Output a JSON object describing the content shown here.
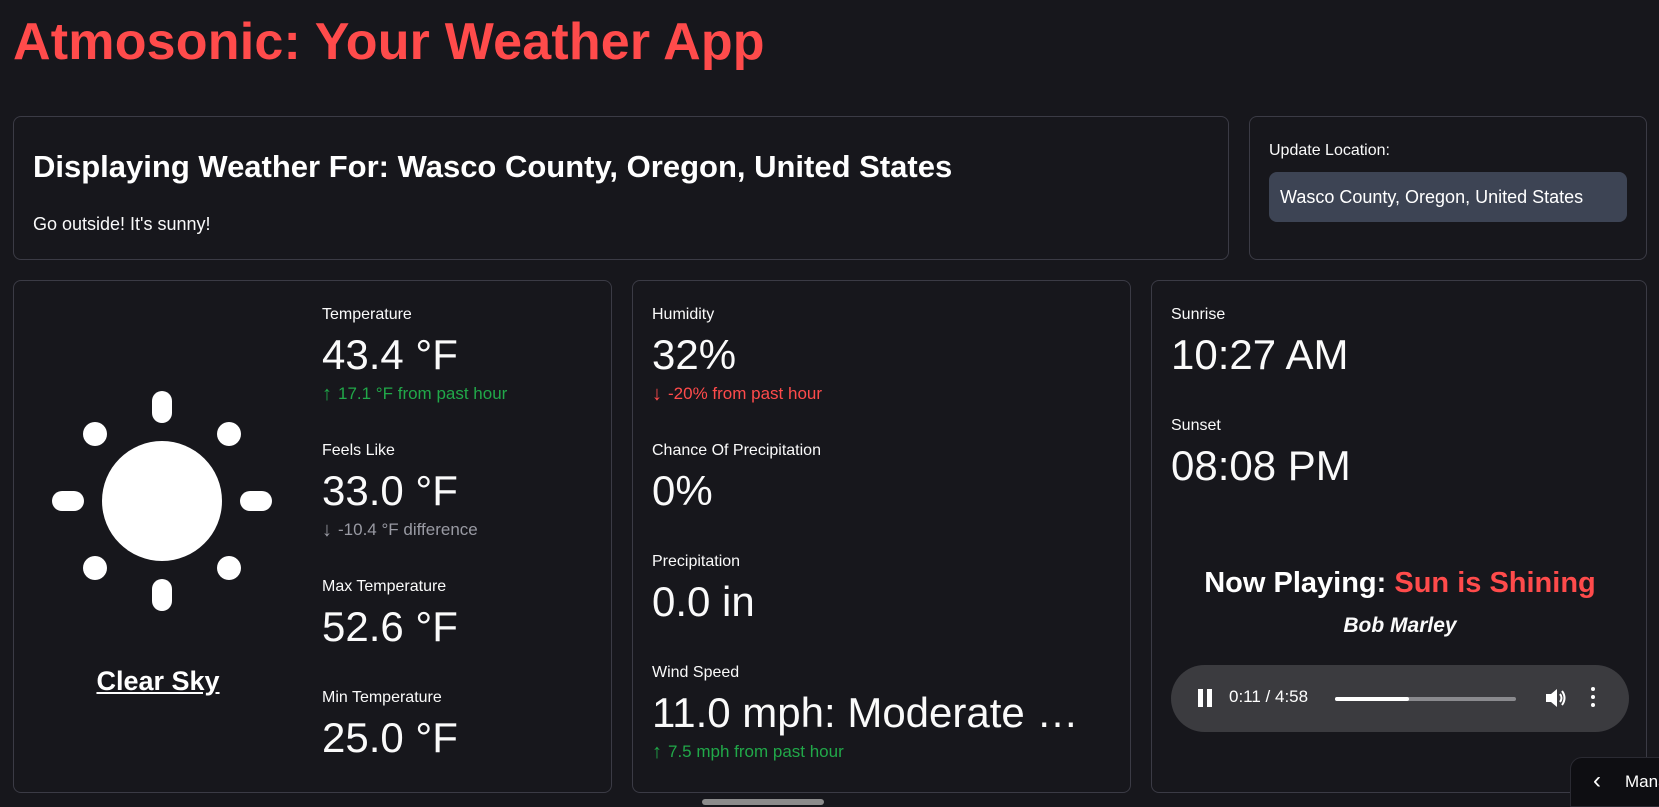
{
  "app": {
    "title": "Atmosonic: Your Weather App"
  },
  "header": {
    "title": "Displaying Weather For: Wasco County, Oregon, United States",
    "subtitle": "Go outside! It's sunny!"
  },
  "location": {
    "label": "Update Location:",
    "value": "Wasco County, Oregon, United States"
  },
  "condition": {
    "label": "Clear Sky",
    "icon": "sun-icon"
  },
  "metrics": {
    "temperature": {
      "label": "Temperature",
      "value": "43.4 °F",
      "delta": "17.1 °F from past hour",
      "direction": "up"
    },
    "feels_like": {
      "label": "Feels Like",
      "value": "33.0 °F",
      "delta": "-10.4 °F difference",
      "direction": "off"
    },
    "max_temp": {
      "label": "Max Temperature",
      "value": "52.6 °F"
    },
    "min_temp": {
      "label": "Min Temperature",
      "value": "25.0 °F"
    },
    "humidity": {
      "label": "Humidity",
      "value": "32%",
      "delta": "-20% from past hour",
      "direction": "down"
    },
    "precip_chance": {
      "label": "Chance Of Precipitation",
      "value": "0%"
    },
    "precipitation": {
      "label": "Precipitation",
      "value": "0.0 in"
    },
    "wind": {
      "label": "Wind Speed",
      "value": "11.0 mph: Moderate …",
      "delta": "7.5 mph from past hour",
      "direction": "up"
    },
    "sunrise": {
      "label": "Sunrise",
      "value": "10:27 AM"
    },
    "sunset": {
      "label": "Sunset",
      "value": "08:08 PM"
    }
  },
  "music": {
    "prefix": "Now Playing: ",
    "song": "Sun is Shining",
    "artist": "Bob Marley",
    "time": "0:11 / 4:58",
    "progress_fraction": 0.41
  },
  "sidebar_tab": {
    "label": "Manage app"
  },
  "colors": {
    "accent": "#ff4b4b",
    "positive": "#21a849",
    "neutral": "#999aa3",
    "background": "#17171c",
    "input_bg": "#3d4454"
  }
}
